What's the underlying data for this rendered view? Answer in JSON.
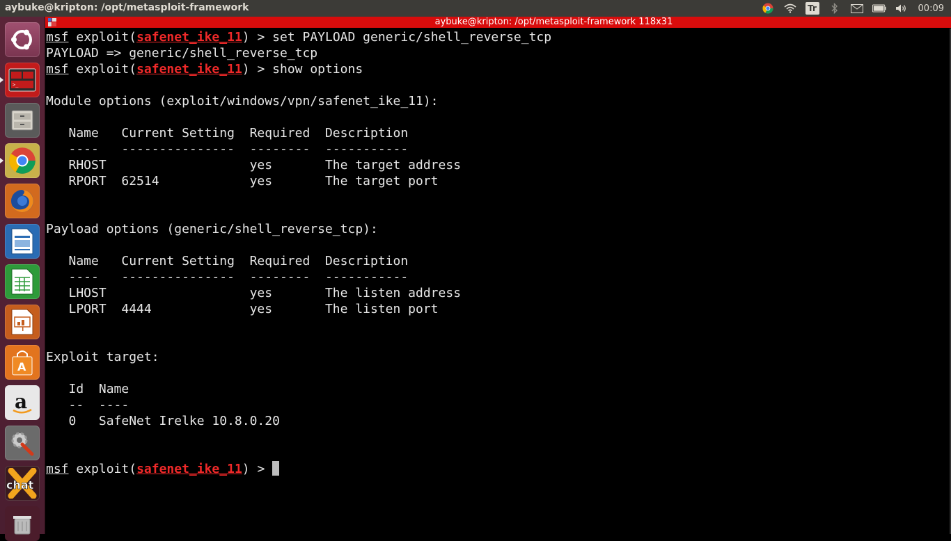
{
  "topbar": {
    "window_title": "aybuke@kripton: /opt/metasploit-framework",
    "keyboard_layout": "Tr",
    "clock": "00:09",
    "icons": [
      "chrome-icon",
      "wifi-icon",
      "keyboard-layout-icon",
      "bluetooth-icon",
      "mail-icon",
      "battery-icon",
      "volume-icon"
    ]
  },
  "launcher": {
    "items": [
      {
        "name": "ubuntu-dash",
        "icon": "ubuntu-logo-icon"
      },
      {
        "name": "terminal",
        "icon": "terminal-icon",
        "active": true
      },
      {
        "name": "files",
        "icon": "file-cabinet-icon"
      },
      {
        "name": "chrome",
        "icon": "chrome-icon",
        "running": true
      },
      {
        "name": "firefox",
        "icon": "firefox-icon"
      },
      {
        "name": "libreoffice-writer",
        "icon": "writer-icon"
      },
      {
        "name": "libreoffice-calc",
        "icon": "calc-icon"
      },
      {
        "name": "libreoffice-impress",
        "icon": "impress-icon"
      },
      {
        "name": "software-center",
        "icon": "shopping-bag-icon"
      },
      {
        "name": "amazon",
        "icon": "amazon-icon"
      },
      {
        "name": "system-settings",
        "icon": "settings-icon"
      },
      {
        "name": "xchat",
        "icon": "xchat-icon"
      },
      {
        "name": "trash",
        "icon": "trash-icon"
      }
    ]
  },
  "terminal": {
    "title": "aybuke@kripton: /opt/metasploit-framework 118x31",
    "prompt_msf": "msf",
    "prompt_exploit": " exploit(",
    "module_short": "safenet_ike_11",
    "prompt_end": ") > ",
    "cmd1": "set PAYLOAD generic/shell_reverse_tcp",
    "out1": "PAYLOAD => generic/shell_reverse_tcp",
    "cmd2": "show options",
    "module_options_heading": "Module options (exploit/windows/vpn/safenet_ike_11):",
    "module_header": "   Name   Current Setting  Required  Description",
    "module_sep": "   ----   ---------------  --------  -----------",
    "module_rows": [
      "   RHOST                   yes       The target address",
      "   RPORT  62514            yes       The target port"
    ],
    "payload_options_heading": "Payload options (generic/shell_reverse_tcp):",
    "payload_header": "   Name   Current Setting  Required  Description",
    "payload_sep": "   ----   ---------------  --------  -----------",
    "payload_rows": [
      "   LHOST                   yes       The listen address",
      "   LPORT  4444             yes       The listen port"
    ],
    "target_heading": "Exploit target:",
    "target_header": "   Id  Name",
    "target_sep": "   --  ----",
    "target_rows": [
      "   0   SafeNet Irelke 10.8.0.20"
    ]
  },
  "colors": {
    "titlebar": "#d80c0c",
    "prompt_module": "#ef2929",
    "panel": "#3c3b37",
    "launcher": "#5a2438"
  }
}
